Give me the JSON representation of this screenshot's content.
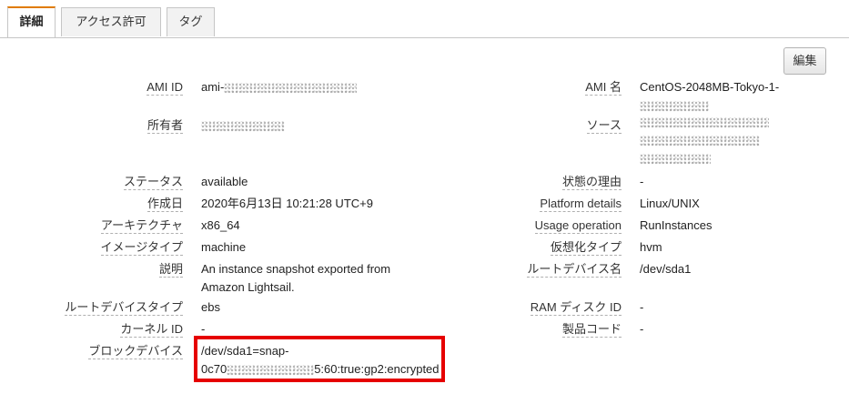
{
  "tabs": [
    {
      "label": "詳細",
      "active": true
    },
    {
      "label": "アクセス許可",
      "active": false
    },
    {
      "label": "タグ",
      "active": false
    }
  ],
  "edit_button": "編集",
  "left_fields": [
    {
      "label": "AMI ID",
      "value": "ami-",
      "redacted_suffix": true
    },
    {
      "label": "所有者",
      "value": "",
      "redacted_suffix": true
    },
    {
      "label": "ステータス",
      "value": "available"
    },
    {
      "label": "作成日",
      "value": "2020年6月13日 10:21:28 UTC+9"
    },
    {
      "label": "アーキテクチャ",
      "value": "x86_64"
    },
    {
      "label": "イメージタイプ",
      "value": "machine"
    },
    {
      "label": "説明",
      "value_line1": "An instance snapshot exported from",
      "value_line2": "Amazon Lightsail."
    },
    {
      "label": "ルートデバイスタイプ",
      "value": "ebs"
    },
    {
      "label": "カーネル ID",
      "value": "-"
    },
    {
      "label": "ブロックデバイス",
      "value_line1": "/dev/sda1=snap-",
      "value_line2_prefix": "0c70",
      "value_line2_suffix": "5:60:true:gp2:encrypted"
    }
  ],
  "right_fields": [
    {
      "label": "AMI 名",
      "value": "CentOS-2048MB-Tokyo-1-"
    },
    {
      "label": "ソース",
      "value": ""
    },
    {
      "label": "状態の理由",
      "value": "-"
    },
    {
      "label": "Platform details",
      "value": "Linux/UNIX"
    },
    {
      "label": "Usage operation",
      "value": "RunInstances"
    },
    {
      "label": "仮想化タイプ",
      "value": "hvm"
    },
    {
      "label": "ルートデバイス名",
      "value": "/dev/sda1"
    },
    {
      "label": "RAM ディスク ID",
      "value": "-"
    },
    {
      "label": "製品コード",
      "value": "-"
    }
  ],
  "colors": {
    "highlight_border": "#e60000",
    "active_tab_accent": "#e07b00"
  }
}
